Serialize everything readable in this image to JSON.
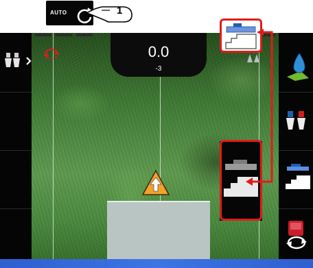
{
  "auto_button": {
    "label": "AUTO",
    "callout_number": "1"
  },
  "readout": {
    "value": "0.0",
    "sub_value": "-3"
  },
  "left_panel": {
    "icons": [
      "double-nozzle-icon",
      "expand-chevron-icon"
    ]
  },
  "right_panel": {
    "icons": [
      "drop-on-field-icon",
      "red-blue-nozzle-icon",
      "section-control-icon",
      "machine-rotate-icon"
    ]
  },
  "overlays": {
    "icons": [
      "double-arrow-rotate-icon",
      "vehicle-position-triangle-icon",
      "gray-nozzle-pair-icon"
    ]
  },
  "callouts": {
    "top_icon": "section-mode-small-icon",
    "large_icon": "section-mode-large-icon"
  },
  "colors": {
    "accent_red": "#e11b1b",
    "strip_marker": "#b7dd28",
    "bottom_bar": "#3d74e6",
    "vehicle_orange": "#f3a12a"
  }
}
